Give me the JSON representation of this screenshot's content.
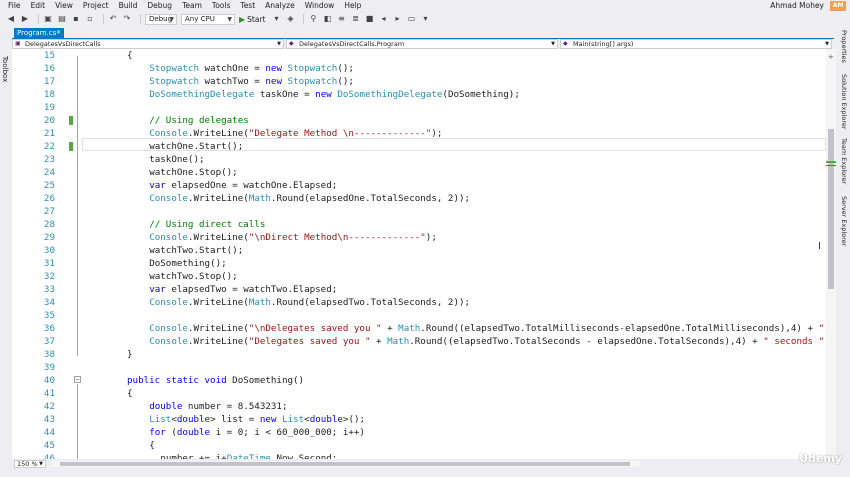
{
  "menu": [
    "File",
    "Edit",
    "View",
    "Project",
    "Build",
    "Debug",
    "Team",
    "Tools",
    "Test",
    "Analyze",
    "Window",
    "Help"
  ],
  "user": {
    "name": "Ahmad Mohey",
    "initials": "AM"
  },
  "toolbar": {
    "config": "Debug",
    "platform": "Any CPU",
    "start_label": "Start"
  },
  "side": {
    "toolbox": "Toolbox",
    "right": [
      "Properties",
      "Solution Explorer",
      "Team Explorer",
      "Server Explorer"
    ]
  },
  "tab": {
    "label": "Program.cs",
    "close": "✕"
  },
  "nav": {
    "project": "DelegatesVsDirectCalls",
    "type": "DelegatesVsDirectCalls.Program",
    "member": "Main(string[] args)"
  },
  "editor": {
    "lines": [
      {
        "n": "15",
        "indent": 0,
        "tokens": [
          [
            "p",
            "{"
          ]
        ]
      },
      {
        "n": "16",
        "indent": 4,
        "tokens": [
          [
            "t",
            "Stopwatch"
          ],
          [
            "p",
            " watchOne = "
          ],
          [
            "k",
            "new"
          ],
          [
            "p",
            " "
          ],
          [
            "t",
            "Stopwatch"
          ],
          [
            "p",
            "();"
          ]
        ]
      },
      {
        "n": "17",
        "indent": 4,
        "tokens": [
          [
            "t",
            "Stopwatch"
          ],
          [
            "p",
            " watchTwo = "
          ],
          [
            "k",
            "new"
          ],
          [
            "p",
            " "
          ],
          [
            "t",
            "Stopwatch"
          ],
          [
            "p",
            "();"
          ]
        ]
      },
      {
        "n": "18",
        "indent": 4,
        "tokens": [
          [
            "t",
            "DoSomethingDelegate"
          ],
          [
            "p",
            " taskOne = "
          ],
          [
            "k",
            "new"
          ],
          [
            "p",
            " "
          ],
          [
            "t",
            "DoSomethingDelegate"
          ],
          [
            "p",
            "(DoSomething);"
          ]
        ]
      },
      {
        "n": "19",
        "indent": 0,
        "tokens": []
      },
      {
        "n": "20",
        "indent": 4,
        "tokens": [
          [
            "c",
            "// Using delegates"
          ]
        ]
      },
      {
        "n": "21",
        "indent": 4,
        "tokens": [
          [
            "t",
            "Console"
          ],
          [
            "p",
            ".WriteLine("
          ],
          [
            "s",
            "\"Delegate Method \\n-------------\""
          ],
          [
            "p",
            ");"
          ]
        ]
      },
      {
        "n": "22",
        "indent": 4,
        "tokens": [
          [
            "p",
            "watchOne.Start();"
          ]
        ]
      },
      {
        "n": "23",
        "indent": 4,
        "tokens": [
          [
            "p",
            "taskOne();"
          ]
        ]
      },
      {
        "n": "24",
        "indent": 4,
        "tokens": [
          [
            "p",
            "watchOne.Stop();"
          ]
        ]
      },
      {
        "n": "25",
        "indent": 4,
        "tokens": [
          [
            "k",
            "var"
          ],
          [
            "p",
            " elapsedOne = watchOne.Elapsed;"
          ]
        ]
      },
      {
        "n": "26",
        "indent": 4,
        "tokens": [
          [
            "t",
            "Console"
          ],
          [
            "p",
            ".WriteLine("
          ],
          [
            "t",
            "Math"
          ],
          [
            "p",
            ".Round(elapsedOne.TotalSeconds, 2));"
          ]
        ]
      },
      {
        "n": "27",
        "indent": 0,
        "tokens": []
      },
      {
        "n": "28",
        "indent": 4,
        "tokens": [
          [
            "c",
            "// Using direct calls"
          ]
        ]
      },
      {
        "n": "29",
        "indent": 4,
        "tokens": [
          [
            "t",
            "Console"
          ],
          [
            "p",
            ".WriteLine("
          ],
          [
            "s",
            "\"\\nDirect Method\\n-------------\""
          ],
          [
            "p",
            ");"
          ]
        ]
      },
      {
        "n": "30",
        "indent": 4,
        "tokens": [
          [
            "p",
            "watchTwo.Start();"
          ]
        ]
      },
      {
        "n": "31",
        "indent": 4,
        "tokens": [
          [
            "p",
            "DoSomething();"
          ]
        ]
      },
      {
        "n": "32",
        "indent": 4,
        "tokens": [
          [
            "p",
            "watchTwo.Stop();"
          ]
        ]
      },
      {
        "n": "33",
        "indent": 4,
        "tokens": [
          [
            "k",
            "var"
          ],
          [
            "p",
            " elapsedTwo = watchTwo.Elapsed;"
          ]
        ]
      },
      {
        "n": "34",
        "indent": 4,
        "tokens": [
          [
            "t",
            "Console"
          ],
          [
            "p",
            ".WriteLine("
          ],
          [
            "t",
            "Math"
          ],
          [
            "p",
            ".Round(elapsedTwo.TotalSeconds, 2));"
          ]
        ]
      },
      {
        "n": "35",
        "indent": 0,
        "tokens": []
      },
      {
        "n": "36",
        "indent": 4,
        "tokens": [
          [
            "t",
            "Console"
          ],
          [
            "p",
            ".WriteLine("
          ],
          [
            "s",
            "\"\\nDelegates saved you \""
          ],
          [
            "p",
            " + "
          ],
          [
            "t",
            "Math"
          ],
          [
            "p",
            ".Round((elapsedTwo.TotalMilliseconds-elapsedOne.TotalMilliseconds),4) + "
          ],
          [
            "s",
            "\" mi"
          ]
        ]
      },
      {
        "n": "37",
        "indent": 4,
        "tokens": [
          [
            "t",
            "Console"
          ],
          [
            "p",
            ".WriteLine("
          ],
          [
            "s",
            "\"Delegates saved you \""
          ],
          [
            "p",
            " + "
          ],
          [
            "t",
            "Math"
          ],
          [
            "p",
            ".Round((elapsedTwo.TotalSeconds - elapsedOne.TotalSeconds),4) + "
          ],
          [
            "s",
            "\" seconds \""
          ],
          [
            "p",
            ");"
          ]
        ]
      },
      {
        "n": "38",
        "indent": 0,
        "tokens": [
          [
            "p",
            "}"
          ]
        ]
      },
      {
        "n": "39",
        "indent": 0,
        "tokens": []
      },
      {
        "n": "40",
        "indent": 0,
        "tokens": [
          [
            "k",
            "public"
          ],
          [
            "p",
            " "
          ],
          [
            "k",
            "static"
          ],
          [
            "p",
            " "
          ],
          [
            "k",
            "void"
          ],
          [
            "p",
            " DoSomething()"
          ]
        ]
      },
      {
        "n": "41",
        "indent": 0,
        "tokens": [
          [
            "p",
            "{"
          ]
        ]
      },
      {
        "n": "42",
        "indent": 4,
        "tokens": [
          [
            "k",
            "double"
          ],
          [
            "p",
            " number = 8.543231;"
          ]
        ]
      },
      {
        "n": "43",
        "indent": 4,
        "tokens": [
          [
            "t",
            "List"
          ],
          [
            "p",
            "<"
          ],
          [
            "k",
            "double"
          ],
          [
            "p",
            "> list = "
          ],
          [
            "k",
            "new"
          ],
          [
            "p",
            " "
          ],
          [
            "t",
            "List"
          ],
          [
            "p",
            "<"
          ],
          [
            "k",
            "double"
          ],
          [
            "p",
            ">();"
          ]
        ]
      },
      {
        "n": "44",
        "indent": 4,
        "tokens": [
          [
            "k",
            "for"
          ],
          [
            "p",
            " ("
          ],
          [
            "k",
            "double"
          ],
          [
            "p",
            " i = 0; i < 60_000_000; i++)"
          ]
        ]
      },
      {
        "n": "45",
        "indent": 4,
        "tokens": [
          [
            "p",
            "{"
          ]
        ]
      },
      {
        "n": "46",
        "indent": 6,
        "tokens": [
          [
            "p",
            "number += i+"
          ],
          [
            "t",
            "DateTime"
          ],
          [
            "p",
            ".Now.Second;"
          ]
        ]
      }
    ]
  },
  "zoom": "150 %",
  "watermark": "Udemy"
}
